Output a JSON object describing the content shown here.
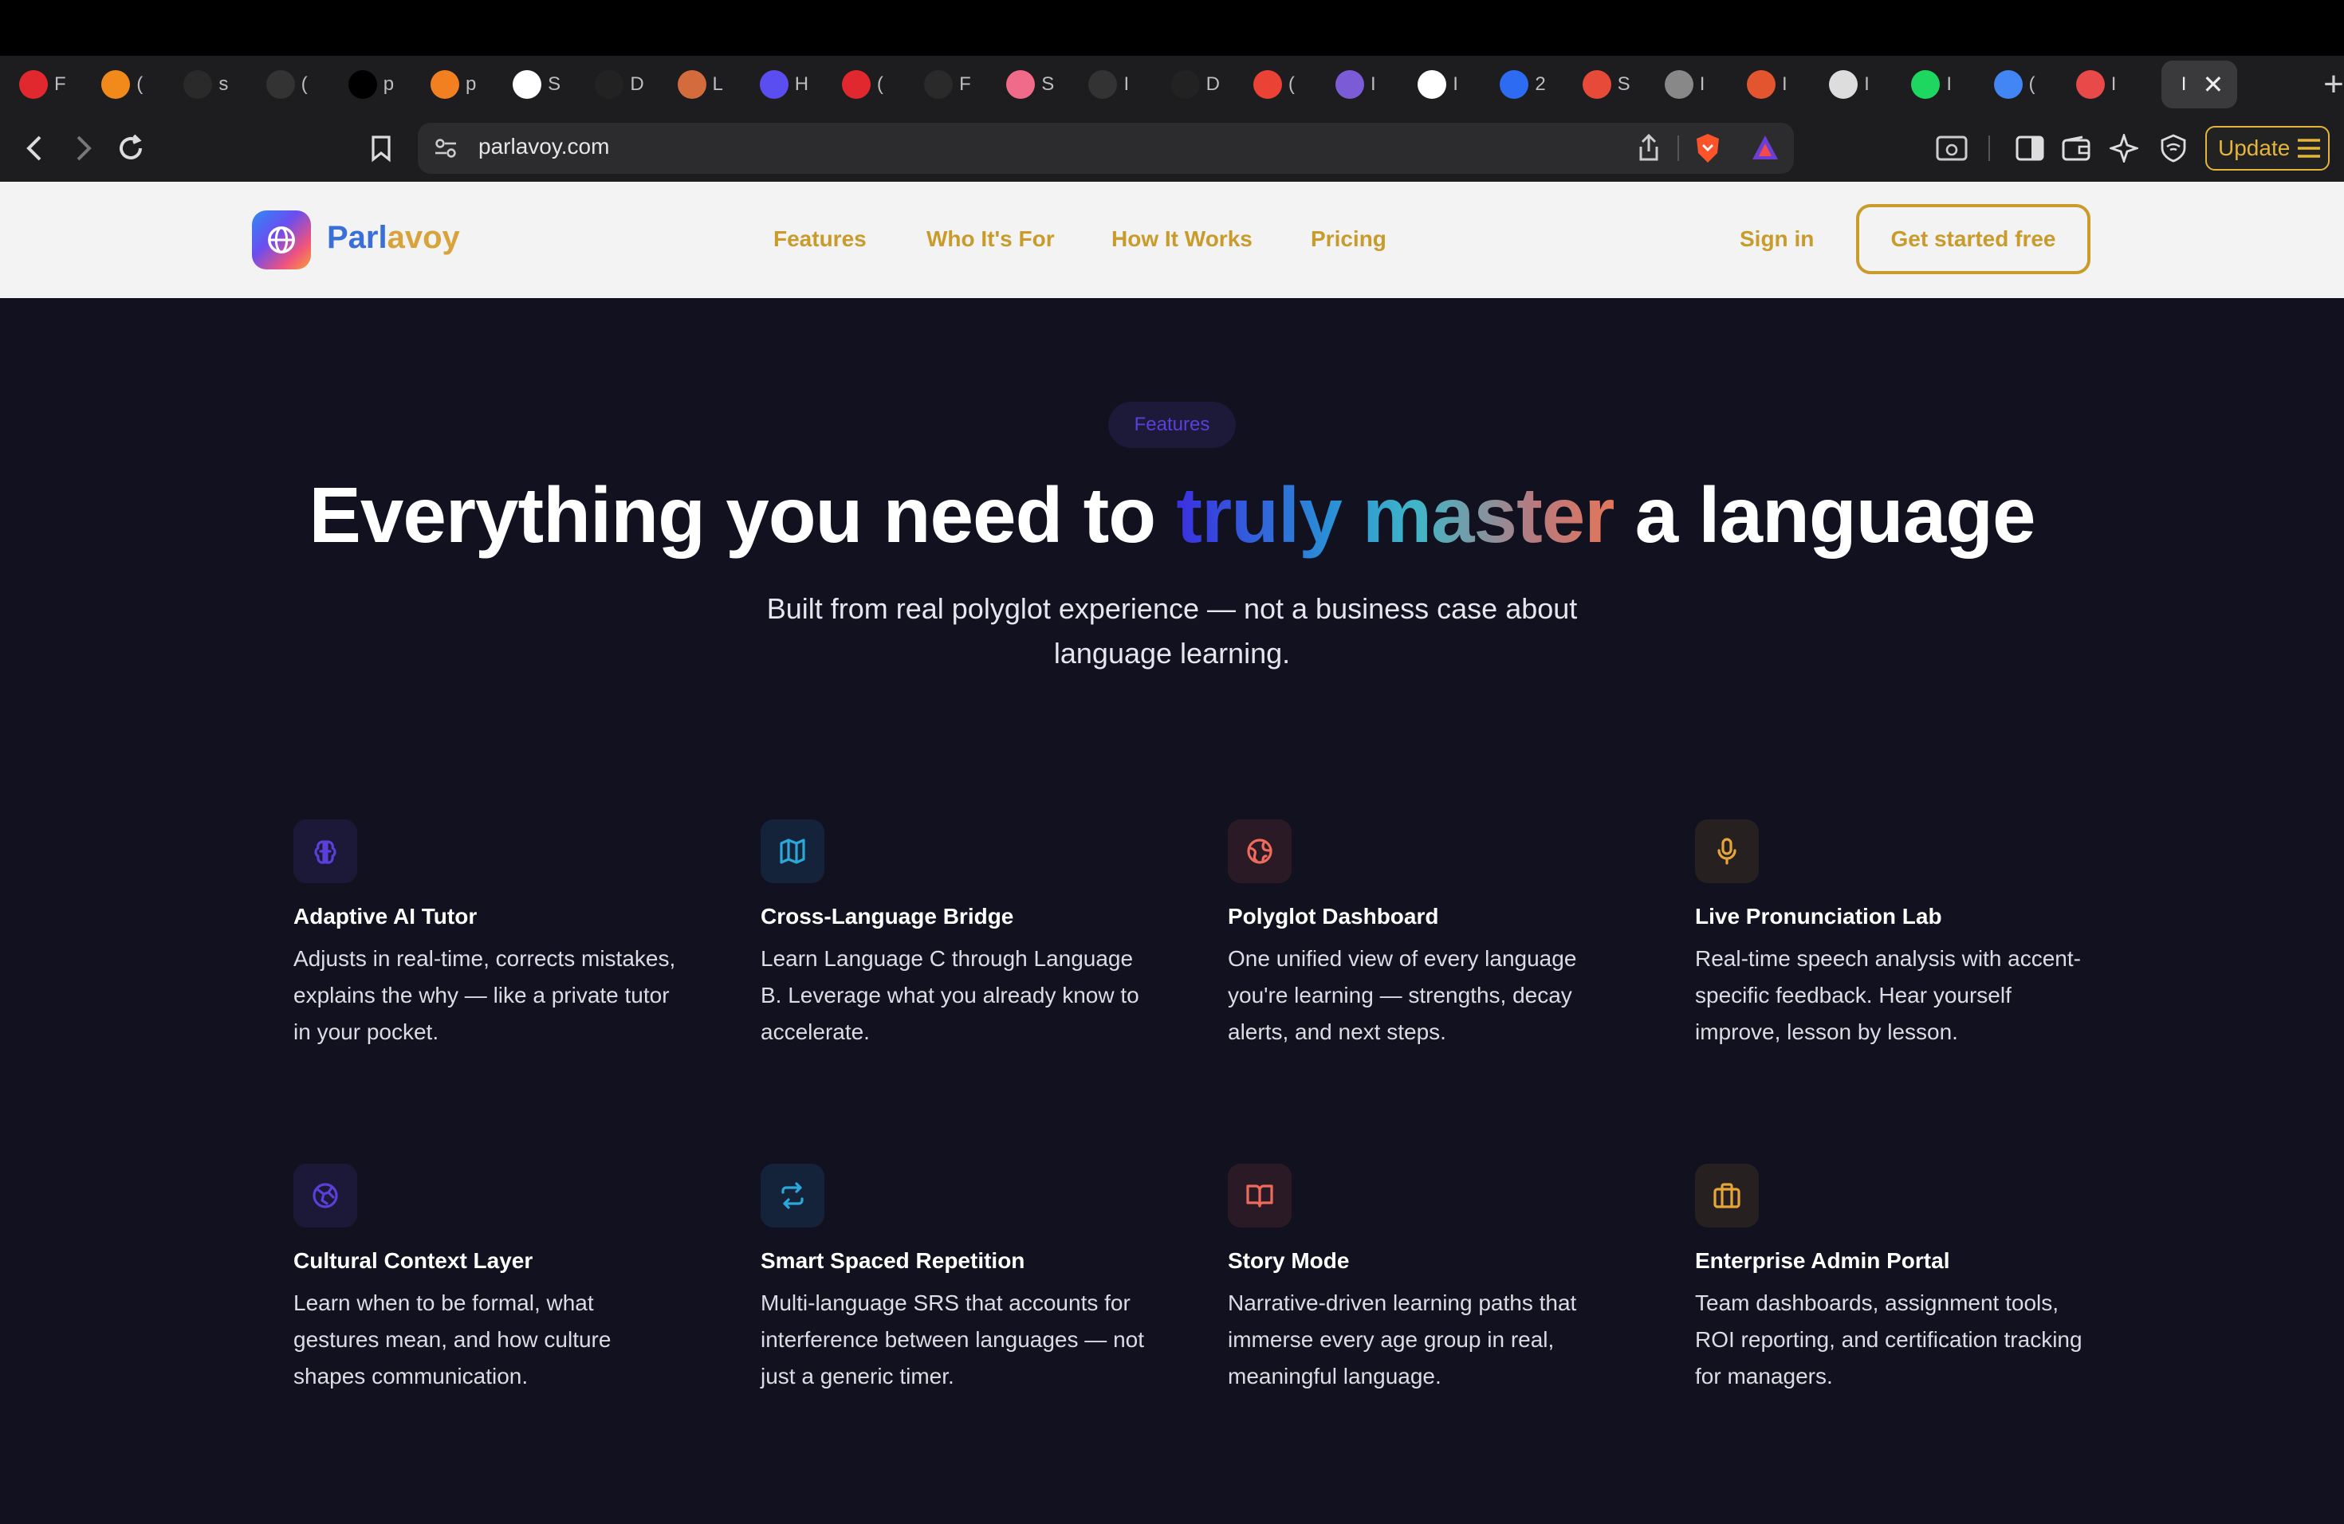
{
  "browser": {
    "tabs": [
      {
        "icon": "red-tab-icon",
        "color": "#e0282e",
        "label": "F"
      },
      {
        "icon": "orange-hexagon-tab-icon",
        "color": "#f28a1b",
        "label": "("
      },
      {
        "icon": "dark-circle-tab-icon",
        "color": "#2a2a2a",
        "label": "s"
      },
      {
        "icon": "github-tab-icon",
        "color": "#333",
        "label": "("
      },
      {
        "icon": "triangle-tab-icon",
        "color": "#000",
        "label": "p"
      },
      {
        "icon": "cloudflare-tab-icon",
        "color": "#f38020",
        "label": "p"
      },
      {
        "icon": "pause-tab-icon",
        "color": "#fff",
        "label": "S"
      },
      {
        "icon": "r-circle-tab-icon",
        "color": "#222",
        "label": "D"
      },
      {
        "icon": "image-tab-icon",
        "color": "#d46b3c",
        "label": "L"
      },
      {
        "icon": "purple-tab-icon",
        "color": "#5b4ef0",
        "label": "H"
      },
      {
        "icon": "red-ring-tab-icon",
        "color": "#e0282e",
        "label": "("
      },
      {
        "icon": "dark-circle-tab-icon",
        "color": "#2a2a2a",
        "label": "F"
      },
      {
        "icon": "star-tab-icon",
        "color": "#f06a8a",
        "label": "S"
      },
      {
        "icon": "wix-tab-icon",
        "color": "#333",
        "label": "I"
      },
      {
        "icon": "u-circle-tab-icon",
        "color": "#222",
        "label": "D"
      },
      {
        "icon": "gmail-tab-icon",
        "color": "#ea4335",
        "label": "("
      },
      {
        "icon": "gmail-alt-tab-icon",
        "color": "#7b5cd6",
        "label": "I"
      },
      {
        "icon": "wix-square-tab-icon",
        "color": "#fff",
        "label": "I"
      },
      {
        "icon": "blue-house-tab-icon",
        "color": "#2d6cf2",
        "label": "2"
      },
      {
        "icon": "red-stripes-tab-icon",
        "color": "#e84a3a",
        "label": "S"
      },
      {
        "icon": "globe-tab-icon",
        "color": "#888",
        "label": "I"
      },
      {
        "icon": "sunburst-tab-icon",
        "color": "#e2552f",
        "label": "I"
      },
      {
        "icon": "apple-tab-icon",
        "color": "#ddd",
        "label": "I"
      },
      {
        "icon": "spotify-tab-icon",
        "color": "#1ed760",
        "label": "I"
      },
      {
        "icon": "translate-tab-icon",
        "color": "#4285f4",
        "label": "("
      },
      {
        "icon": "p-circle-tab-icon",
        "color": "#e84a4a",
        "label": "I"
      }
    ],
    "active_tab_label": "I",
    "url": "parlavoy.com",
    "update_label": "Update"
  },
  "site": {
    "brand": {
      "part1": "Parl",
      "part2": "avoy"
    },
    "nav": [
      "Features",
      "Who It's For",
      "How It Works",
      "Pricing"
    ],
    "signin": "Sign in",
    "cta": "Get started free"
  },
  "hero": {
    "badge": "Features",
    "headline_pre": "Everything you need to ",
    "headline_highlight": "truly master",
    "headline_post": " a language",
    "subhead": "Built from real polyglot experience — not a business case about language learning."
  },
  "features": [
    {
      "icon": "brain-icon",
      "color": "#5b3fd9",
      "bg": "#1c1838",
      "title": "Adaptive AI Tutor",
      "desc": "Adjusts in real-time, corrects mistakes, explains the why — like a private tutor in your pocket."
    },
    {
      "icon": "map-icon",
      "color": "#2aa8d8",
      "bg": "#14223a",
      "title": "Cross-Language Bridge",
      "desc": "Learn Language C through Language B. Leverage what you already know to accelerate."
    },
    {
      "icon": "globe-icon",
      "color": "#ee6a5a",
      "bg": "#2a1a26",
      "title": "Polyglot Dashboard",
      "desc": "One unified view of every language you're learning — strengths, decay alerts, and next steps."
    },
    {
      "icon": "microphone-icon",
      "color": "#e5a53a",
      "bg": "#262020",
      "title": "Live Pronunciation Lab",
      "desc": "Real-time speech analysis with accent-specific feedback. Hear yourself improve, lesson by lesson."
    },
    {
      "icon": "cultural-globe-icon",
      "color": "#5b3fd9",
      "bg": "#1c1838",
      "title": "Cultural Context Layer",
      "desc": "Learn when to be formal, what gestures mean, and how culture shapes communication."
    },
    {
      "icon": "repeat-arrows-icon",
      "color": "#2aa8d8",
      "bg": "#14223a",
      "title": "Smart Spaced Repetition",
      "desc": "Multi-language SRS that accounts for interference between languages — not just a generic timer."
    },
    {
      "icon": "book-icon",
      "color": "#ee6a5a",
      "bg": "#2a1a26",
      "title": "Story Mode",
      "desc": "Narrative-driven learning paths that immerse every age group in real, meaningful language."
    },
    {
      "icon": "briefcase-icon",
      "color": "#e5a53a",
      "bg": "#262020",
      "title": "Enterprise Admin Portal",
      "desc": "Team dashboards, assignment tools, ROI reporting, and certification tracking for managers."
    }
  ]
}
